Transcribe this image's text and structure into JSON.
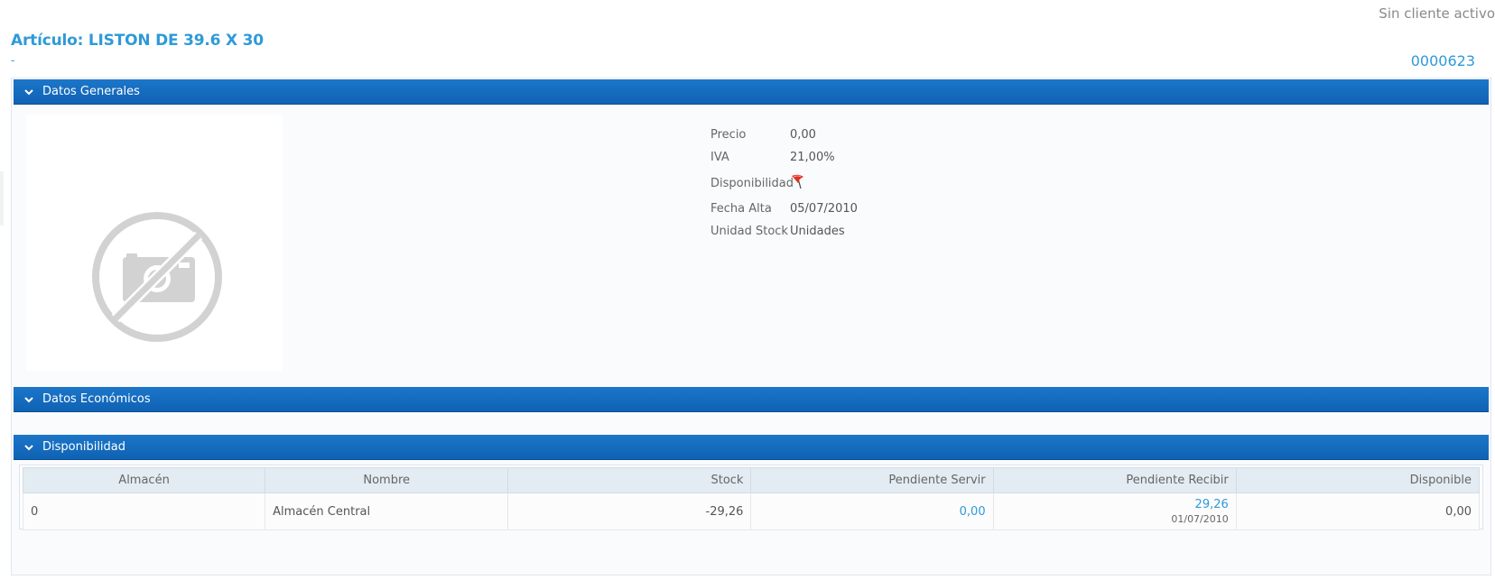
{
  "header": {
    "client_status": "Sin cliente activo",
    "title": "Artículo: LISTON DE 39.6 X 30",
    "subtitle": "-",
    "code": "0000623"
  },
  "panels": {
    "general": "Datos Generales",
    "economic": "Datos Económicos",
    "availability": "Disponibilidad"
  },
  "details": {
    "price_label": "Precio",
    "price_value": "0,00",
    "vat_label": "IVA",
    "vat_value": "21,00%",
    "availability_label": "Disponibilidad",
    "availability_icon": "red-flag-icon",
    "date_label": "Fecha Alta",
    "date_value": "05/07/2010",
    "unit_label": "Unidad Stock",
    "unit_value": "Unidades"
  },
  "table": {
    "headers": [
      "Almacén",
      "Nombre",
      "Stock",
      "Pendiente Servir",
      "Pendiente Recibir",
      "Disponible"
    ],
    "rows": [
      {
        "almacen": "0",
        "nombre": "Almacén Central",
        "stock": "-29,26",
        "pendiente_servir": "0,00",
        "pendiente_recibir": "29,26",
        "pendiente_recibir_date": "01/07/2010",
        "disponible": "0,00"
      }
    ]
  },
  "colors": {
    "accent": "#2e9ad8",
    "panel_header": "#1268bd",
    "flag": "#e0301e"
  }
}
